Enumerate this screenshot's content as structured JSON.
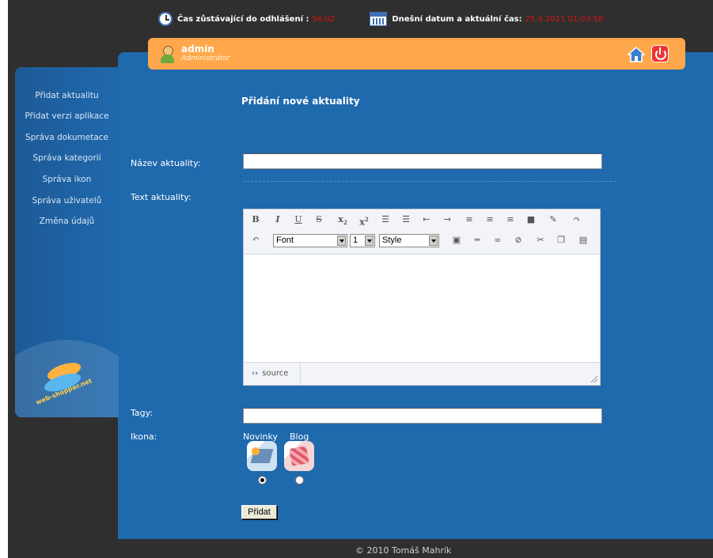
{
  "top": {
    "time_label": "Čas zůstávající do odhlášení :",
    "time_value": "56:02",
    "date_label": "Dnešní datum a aktuální čas:",
    "date_value": "25.4.2011 01:03:58"
  },
  "user": {
    "name": "admin",
    "role": "Administrátor"
  },
  "sidebar": {
    "items": [
      {
        "label": "Přidat aktualitu"
      },
      {
        "label": "Přidat verzi aplikace"
      },
      {
        "label": "Správa dokumetace"
      },
      {
        "label": "Správa kategorií"
      },
      {
        "label": "Správa ikon"
      },
      {
        "label": "Správa uživatelů"
      },
      {
        "label": "Změna údajů"
      }
    ],
    "logo_text": "web-shopper.net"
  },
  "form": {
    "title": "Přidání nové aktuality",
    "name_label": "Název aktuality:",
    "name_value": "",
    "text_label": "Text aktuality:",
    "tags_label": "Tagy:",
    "tags_value": "",
    "icon_label": "Ikona:",
    "icons": [
      {
        "label": "Novinky",
        "selected": true
      },
      {
        "label": "Blog",
        "selected": false
      }
    ],
    "submit_label": "Přidat"
  },
  "editor": {
    "font_select": "Font",
    "size_select": "1",
    "style_select": "Style",
    "source_label": "source"
  },
  "footer": {
    "text": "© 2010  Tomáš Mahrík"
  },
  "colors": {
    "accent_orange": "#ffa84b",
    "panel_blue": "#1f69ad",
    "background": "#2f2f2f",
    "alert_red": "#dd1111"
  }
}
